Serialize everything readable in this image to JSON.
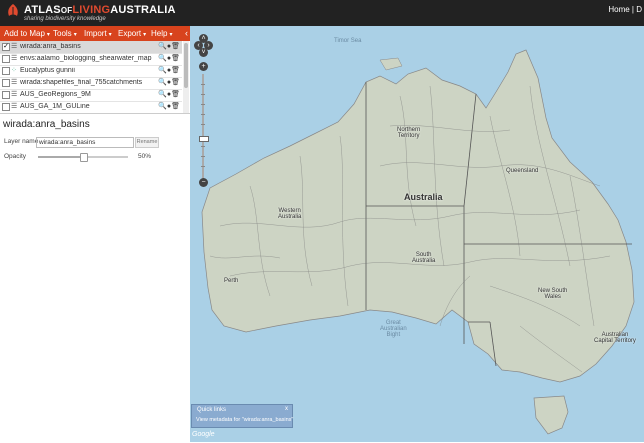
{
  "header": {
    "logo": {
      "part1": "ATLAS",
      "part2": "OF",
      "part3": "LIVING",
      "part4": "AUSTRALIA"
    },
    "tagline": "sharing biodiversity knowledge",
    "links": "Home | D"
  },
  "menubar": {
    "items": [
      "Add to Map",
      "Tools",
      "Import",
      "Export",
      "Help"
    ],
    "caret": "▾",
    "collapse": "‹"
  },
  "layers": [
    {
      "name": "wirada:anra_basins",
      "checked": true,
      "icon": "list-icon",
      "selected": true
    },
    {
      "name": "envs:aalamo_biologging_shearwater_map",
      "checked": false,
      "icon": "list-icon",
      "selected": false
    },
    {
      "name": "Eucalyptus gunnii",
      "checked": false,
      "icon": "scatter-icon",
      "selected": false
    },
    {
      "name": "wirada:shapefiles_final_755catchments",
      "checked": false,
      "icon": "list-icon",
      "selected": false
    },
    {
      "name": "AUS_GeoRegions_9M",
      "checked": false,
      "icon": "list-icon",
      "selected": false
    },
    {
      "name": "AUS_GA_1M_GULine",
      "checked": false,
      "icon": "list-icon",
      "selected": false
    }
  ],
  "layer_tools": "🔍●🗑",
  "details": {
    "title": "wirada:anra_basins",
    "layer_name_label": "Layer name",
    "layer_name_value": "wirada:anra_basins",
    "rename_label": "Rename",
    "opacity_label": "Opacity",
    "opacity_value": 0.5,
    "opacity_text": "50%"
  },
  "map": {
    "labels": {
      "timor_sea": "Timor Sea",
      "northern_territory": "Northern\nTerritory",
      "queensland": "Queensland",
      "australia": "Australia",
      "western_australia": "Western\nAustralia",
      "south_australia": "South\nAustralia",
      "new_south_wales": "New South\nWales",
      "perth": "Perth",
      "great_australian_bight": "Great\nAustralian\nBight",
      "act": "Australian\nCapital Territory"
    },
    "colors": {
      "sea": "#aad0e6",
      "land": "#cdd4c4"
    }
  },
  "quicklinks": {
    "title": "Quick links",
    "close": "x",
    "link": "View metadata for \"wirada:anra_basins\""
  },
  "google": "Google"
}
